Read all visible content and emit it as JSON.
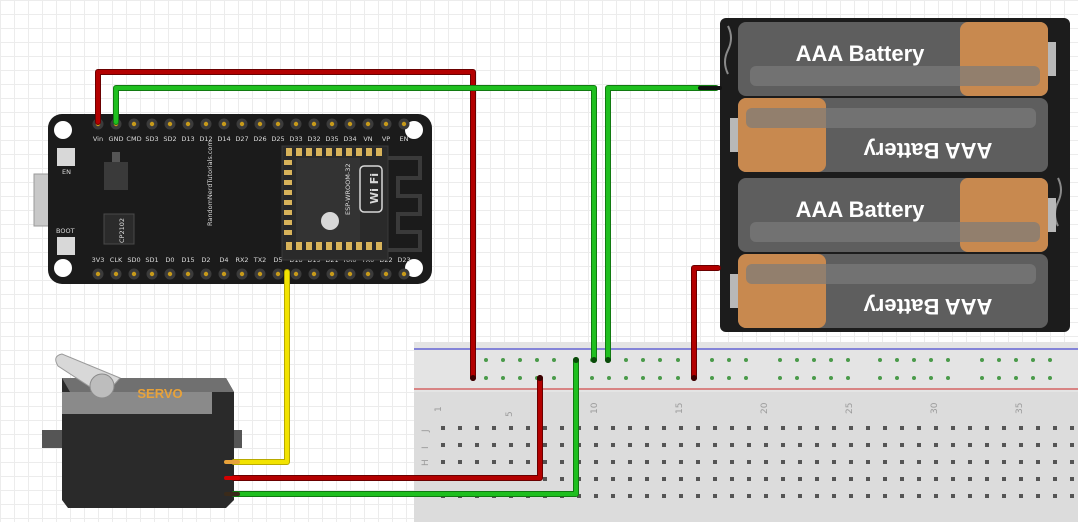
{
  "esp32": {
    "top_pins": [
      "Vin",
      "GND",
      "CMD",
      "SD3",
      "SD2",
      "D13",
      "D12",
      "D14",
      "D27",
      "D26",
      "D25",
      "D33",
      "D32",
      "D35",
      "D34",
      "VN",
      "VP",
      "EN"
    ],
    "bottom_pins": [
      "3V3",
      "CLK",
      "SD0",
      "SD1",
      "D0",
      "D15",
      "D2",
      "D4",
      "RX2",
      "TX2",
      "D5",
      "D18",
      "D19",
      "D21",
      "RX0",
      "TX0",
      "D22",
      "D23"
    ],
    "button_en": "EN",
    "button_boot": "BOOT",
    "chip_label": "CP2102",
    "brand_text": "RandomNerdTutorials.com",
    "module_text": "ESP-WROOM-32",
    "wifi_label": "Wi Fi"
  },
  "batteries": {
    "cell_labels": [
      "AAA Battery",
      "AAA Battery",
      "AAA Battery",
      "AAA Battery"
    ]
  },
  "servo": {
    "label": "SERVO"
  },
  "breadboard": {
    "column_numbers": [
      "1",
      "5",
      "10",
      "15",
      "20",
      "25",
      "30",
      "35"
    ],
    "row_letters": [
      "J",
      "I",
      "H"
    ]
  },
  "colors": {
    "wire_red": "#b30000",
    "wire_green": "#1fbf1f",
    "wire_yellow": "#f2e300",
    "board": "#1b1b1b",
    "servo_label": "#e8a23a"
  }
}
